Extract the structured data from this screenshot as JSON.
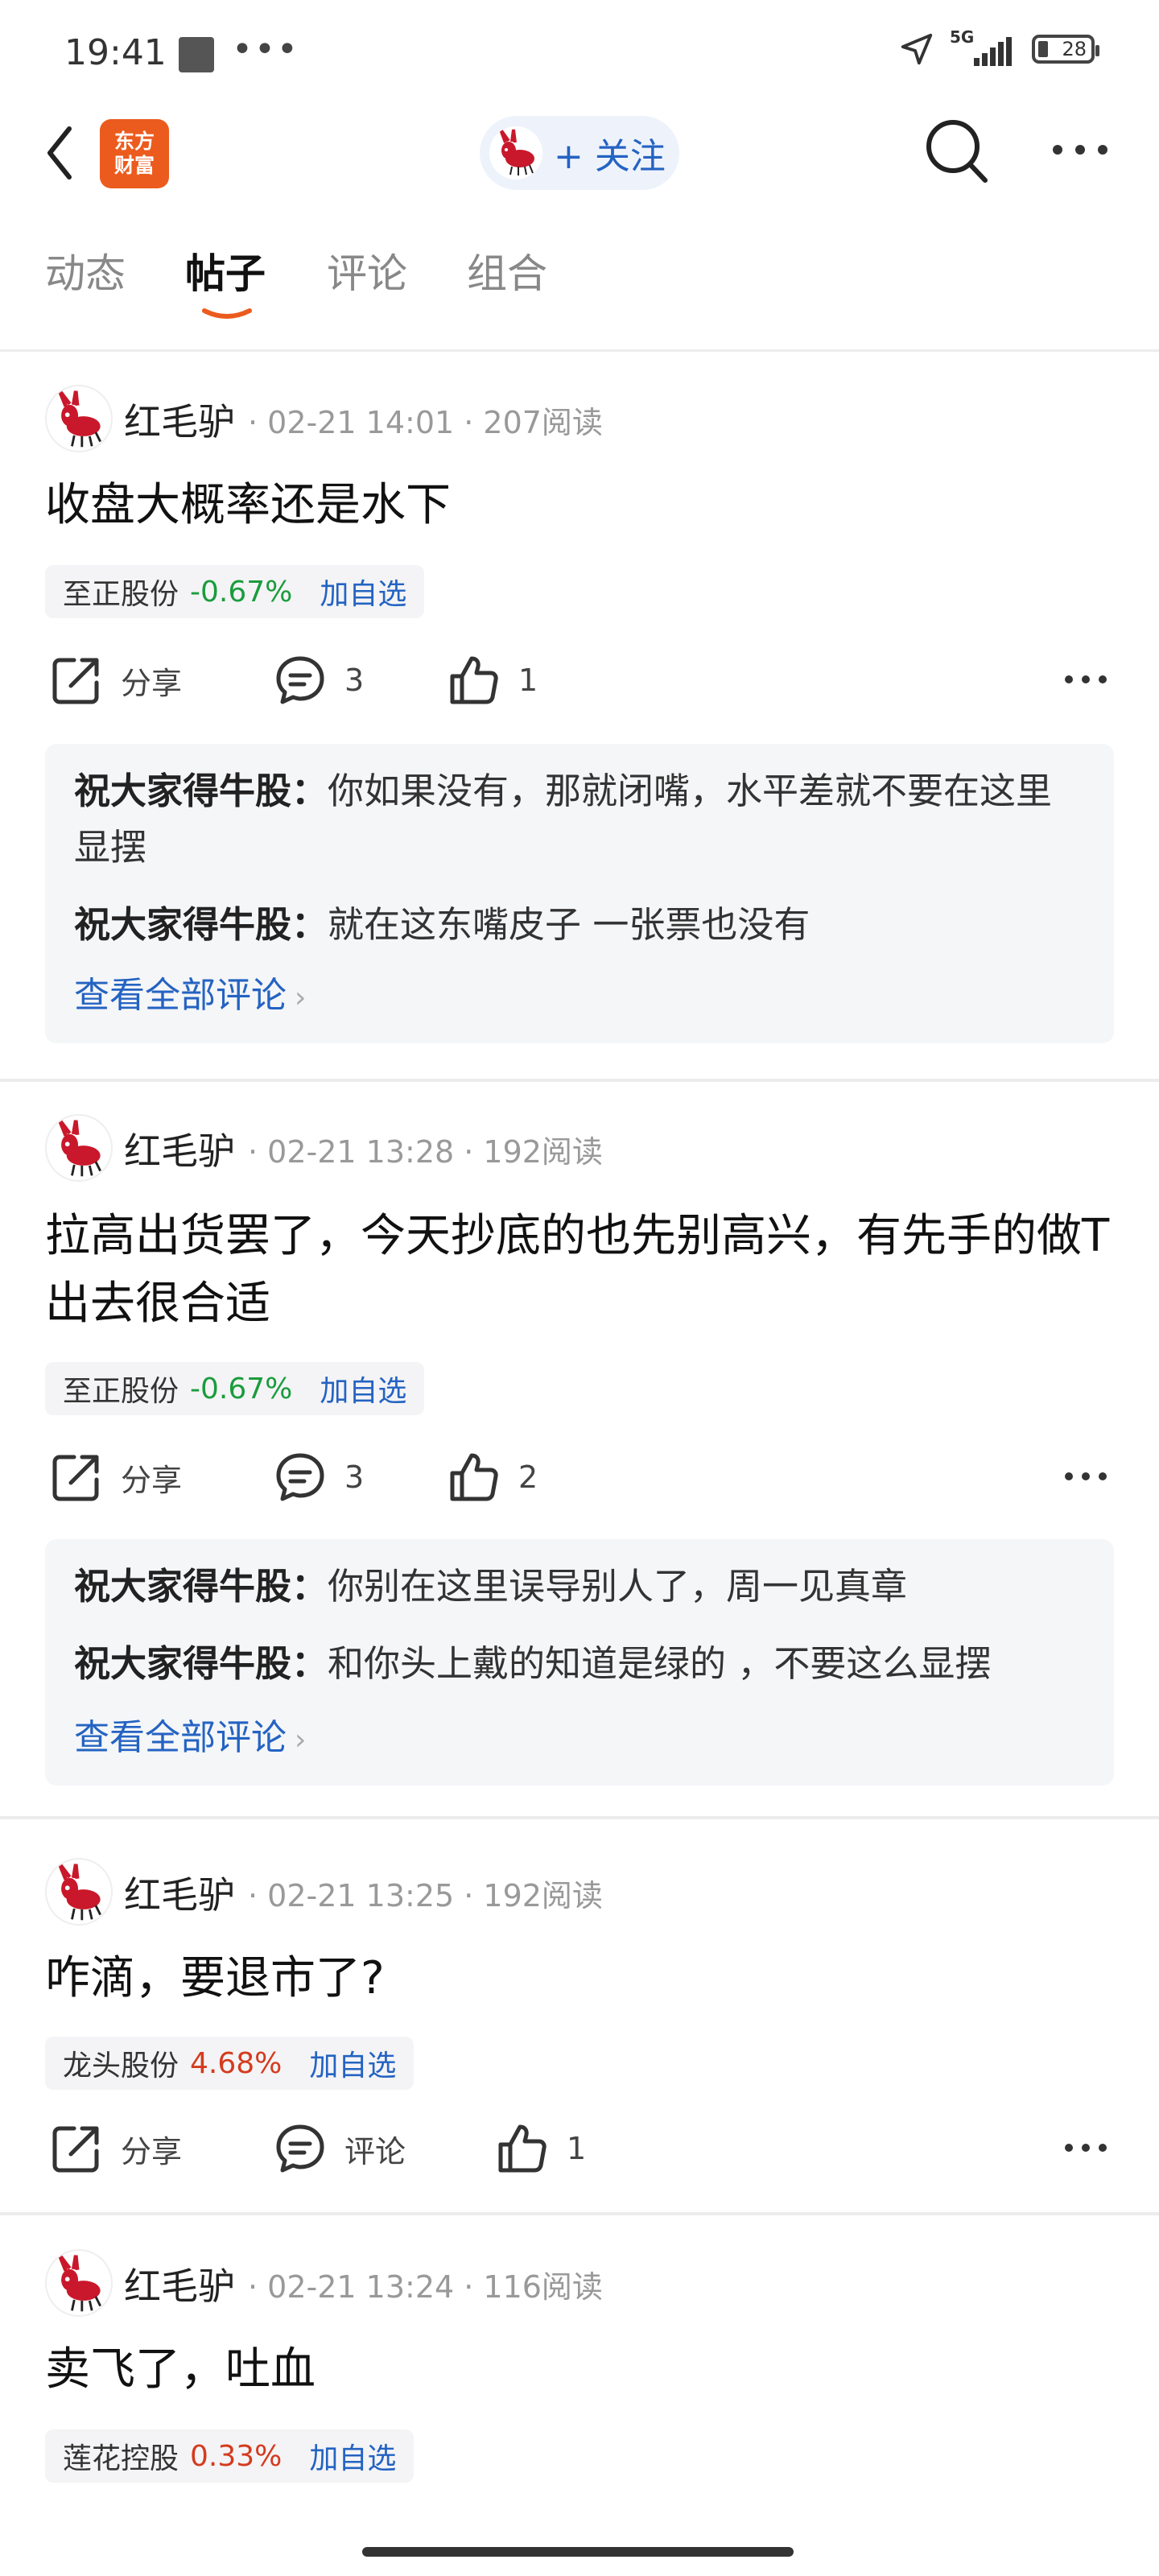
{
  "status_bar": {
    "time": "19:41",
    "dots": "•••",
    "network": "5G",
    "battery": "28"
  },
  "nav": {
    "logo_text_line1": "东方",
    "logo_text_line2": "财富",
    "follow_label": "+ 关注"
  },
  "tabs": [
    {
      "label": "动态",
      "active": false
    },
    {
      "label": "帖子",
      "active": true
    },
    {
      "label": "评论",
      "active": false
    },
    {
      "label": "组合",
      "active": false
    }
  ],
  "accent_color": "#2463c2",
  "posts": [
    {
      "author": "红毛驴",
      "meta": "· 02-21 14:01 · 207阅读",
      "title": "收盘大概率还是水下",
      "stock": {
        "name": "至正股份",
        "change": "-0.67%",
        "direction": "down",
        "add": "加自选"
      },
      "actions": {
        "share": "分享",
        "comment": "3",
        "like": "1"
      },
      "comments": [
        {
          "user": "祝大家得牛股：",
          "text": "你如果没有，那就闭嘴，水平差就不要在这里显摆"
        },
        {
          "user": "祝大家得牛股：",
          "text": "就在这东嘴皮子 一张票也没有"
        }
      ],
      "view_all": "查看全部评论"
    },
    {
      "author": "红毛驴",
      "meta": "· 02-21 13:28 · 192阅读",
      "title": "拉高出货罢了，今天抄底的也先别高兴，有先手的做T出去很合适",
      "stock": {
        "name": "至正股份",
        "change": "-0.67%",
        "direction": "down",
        "add": "加自选"
      },
      "actions": {
        "share": "分享",
        "comment": "3",
        "like": "2"
      },
      "comments": [
        {
          "user": "祝大家得牛股：",
          "text": "你别在这里误导别人了，周一见真章"
        },
        {
          "user": "祝大家得牛股：",
          "text": "和你头上戴的知道是绿的 ，不要这么显摆"
        }
      ],
      "view_all": "查看全部评论"
    },
    {
      "author": "红毛驴",
      "meta": "· 02-21 13:25 · 192阅读",
      "title": "咋滴，要退市了?",
      "stock": {
        "name": "龙头股份",
        "change": "4.68%",
        "direction": "up",
        "add": "加自选"
      },
      "actions": {
        "share": "分享",
        "comment": "评论",
        "like": "1"
      }
    },
    {
      "author": "红毛驴",
      "meta": "· 02-21 13:24 · 116阅读",
      "title": "卖飞了，吐血",
      "stock": {
        "name": "莲花控股",
        "change": "0.33%",
        "direction": "up",
        "add": "加自选"
      }
    }
  ]
}
